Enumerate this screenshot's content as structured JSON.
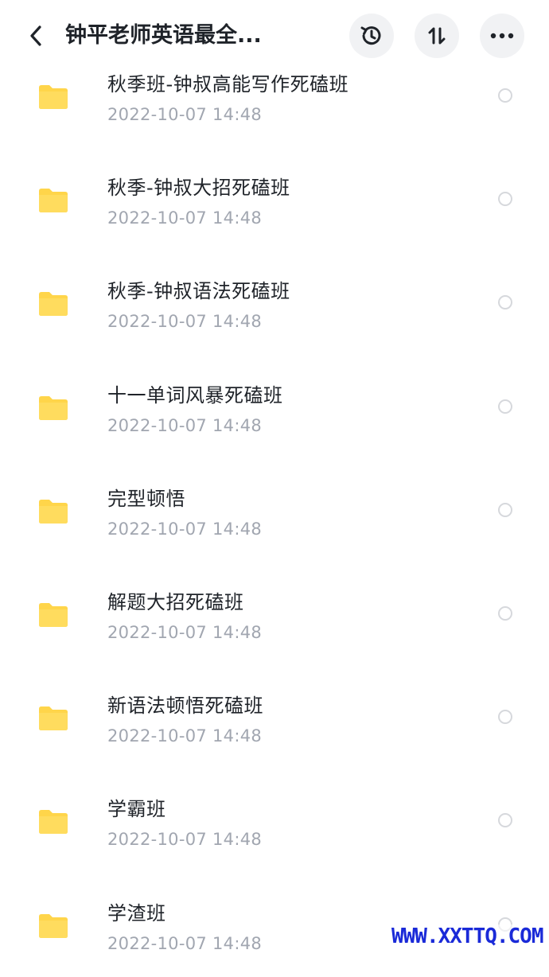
{
  "header": {
    "title": "钟平老师英语最全...",
    "icons": [
      "back-arrow",
      "history-clock",
      "sort-arrows",
      "more-dots"
    ]
  },
  "folders": [
    {
      "name": "秋季班-钟叔高能写作死磕班",
      "date": "2022-10-07  14:48"
    },
    {
      "name": "秋季-钟叔大招死磕班",
      "date": "2022-10-07  14:48"
    },
    {
      "name": "秋季-钟叔语法死磕班",
      "date": "2022-10-07  14:48"
    },
    {
      "name": "十一单词风暴死磕班",
      "date": "2022-10-07  14:48"
    },
    {
      "name": "完型顿悟",
      "date": "2022-10-07  14:48"
    },
    {
      "name": "解题大招死磕班",
      "date": "2022-10-07  14:48"
    },
    {
      "name": "新语法顿悟死磕班",
      "date": "2022-10-07  14:48"
    },
    {
      "name": "学霸班",
      "date": "2022-10-07  14:48"
    },
    {
      "name": "学渣班",
      "date": "2022-10-07  14:48"
    }
  ],
  "watermark": "WWW.XXTTQ.COM",
  "colors": {
    "folder": "#ffd54a",
    "date": "#a1a6b0",
    "header_button_bg": "#f1f2f4",
    "watermark": "#1a2ad8"
  }
}
